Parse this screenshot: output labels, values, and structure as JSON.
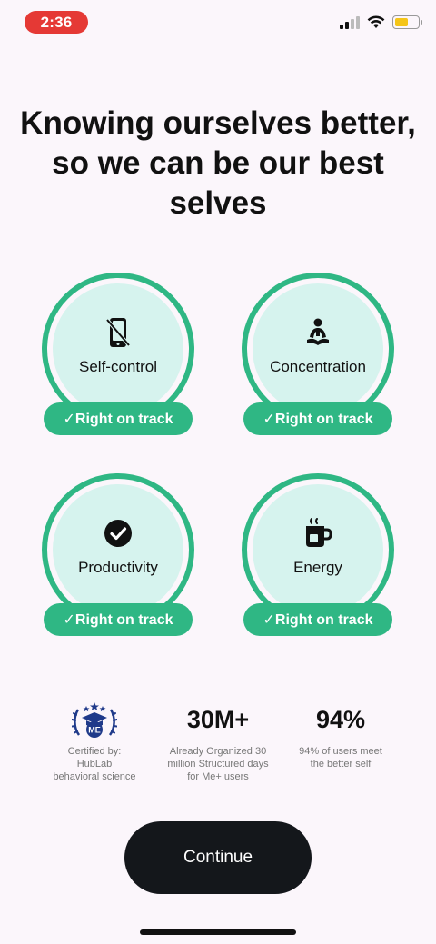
{
  "status_bar": {
    "time": "2:36",
    "signal_icon": "cellular-signal-icon",
    "wifi_icon": "wifi-icon",
    "battery_icon": "battery-icon",
    "battery_color": "#f5c518"
  },
  "headline": "Knowing ourselves better, so we can be our best selves",
  "cards": [
    {
      "label": "Self-control",
      "icon": "phone-off-icon",
      "status": "✓Right on track"
    },
    {
      "label": "Concentration",
      "icon": "meditation-icon",
      "status": "✓Right on track"
    },
    {
      "label": "Productivity",
      "icon": "check-circle-icon",
      "status": "✓Right on track"
    },
    {
      "label": "Energy",
      "icon": "hot-cup-icon",
      "status": "✓Right on track"
    }
  ],
  "stats": [
    {
      "value": "",
      "badge_icon": "certified-badge-icon",
      "desc_lines": [
        "Certified by:",
        "HubLab",
        "behavioral science"
      ]
    },
    {
      "value": "30M+",
      "desc_lines": [
        "Already Organized 30",
        "million Structured days",
        "for Me+ users"
      ]
    },
    {
      "value": "94%",
      "desc_lines": [
        "94% of users meet",
        "the better self"
      ]
    }
  ],
  "continue_label": "Continue",
  "colors": {
    "accent": "#2fb784",
    "card_fill": "#d6f3ee",
    "background": "#fbf6fb",
    "button": "#14171b",
    "time_pill": "#e53935"
  }
}
